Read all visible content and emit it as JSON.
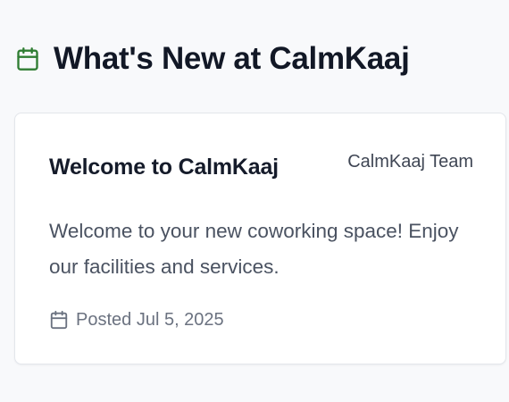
{
  "section": {
    "title": "What's New at CalmKaaj",
    "icon": "calendar-icon",
    "accent_color": "#2f7d32"
  },
  "announcement": {
    "title": "Welcome to CalmKaaj",
    "author": "CalmKaaj Team",
    "body": "Welcome to your new coworking space! Enjoy our facilities and services.",
    "posted": "Posted Jul 5, 2025",
    "posted_icon": "calendar-icon"
  }
}
